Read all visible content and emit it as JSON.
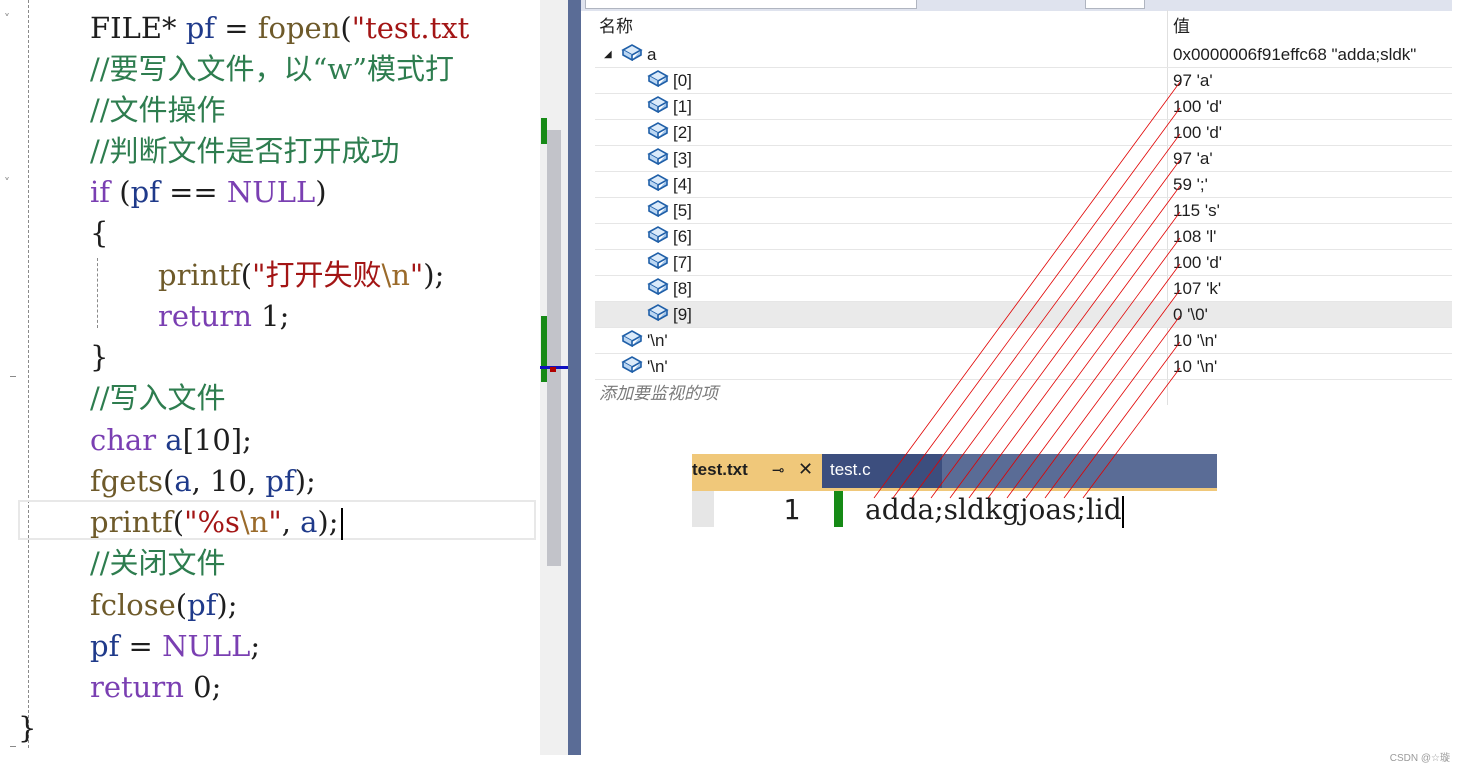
{
  "editor": {
    "lines": [
      [
        {
          "t": "FILE",
          "c": "t-nm"
        },
        {
          "t": "* ",
          "c": "t-nm"
        },
        {
          "t": "pf",
          "c": "t-va"
        },
        {
          "t": " = ",
          "c": "t-nm"
        },
        {
          "t": "fopen",
          "c": "t-fn"
        },
        {
          "t": "(",
          "c": "t-nm"
        },
        {
          "t": "\"test.txt",
          "c": "t-st"
        }
      ],
      [
        {
          "t": "//要写入文件，以“w”模式打",
          "c": "t-cm"
        }
      ],
      [
        {
          "t": "//文件操作",
          "c": "t-cm"
        }
      ],
      [
        {
          "t": "//判断文件是否打开成功",
          "c": "t-cm"
        }
      ],
      [
        {
          "t": "if",
          "c": "t-kw"
        },
        {
          "t": " (",
          "c": "t-nm"
        },
        {
          "t": "pf",
          "c": "t-va"
        },
        {
          "t": " == ",
          "c": "t-nm"
        },
        {
          "t": "NULL",
          "c": "t-mc"
        },
        {
          "t": ")",
          "c": "t-nm"
        }
      ],
      [
        {
          "t": "{",
          "c": "t-nm"
        }
      ],
      [
        {
          "t": "printf",
          "c": "t-fn"
        },
        {
          "t": "(",
          "c": "t-nm"
        },
        {
          "t": "\"打开失败",
          "c": "t-st"
        },
        {
          "t": "\\n",
          "c": "t-es"
        },
        {
          "t": "\"",
          "c": "t-st"
        },
        {
          "t": ");",
          "c": "t-nm"
        }
      ],
      [
        {
          "t": "return",
          "c": "t-kw"
        },
        {
          "t": " 1;",
          "c": "t-nm"
        }
      ],
      [
        {
          "t": "}",
          "c": "t-nm"
        }
      ],
      [
        {
          "t": "//写入文件",
          "c": "t-cm"
        }
      ],
      [
        {
          "t": "char",
          "c": "t-kw"
        },
        {
          "t": " ",
          "c": "t-nm"
        },
        {
          "t": "a",
          "c": "t-va"
        },
        {
          "t": "[10];",
          "c": "t-nm"
        }
      ],
      [
        {
          "t": "fgets",
          "c": "t-fn"
        },
        {
          "t": "(",
          "c": "t-nm"
        },
        {
          "t": "a",
          "c": "t-va"
        },
        {
          "t": ", 10, ",
          "c": "t-nm"
        },
        {
          "t": "pf",
          "c": "t-va"
        },
        {
          "t": ");",
          "c": "t-nm"
        }
      ],
      [
        {
          "t": "printf",
          "c": "t-fn"
        },
        {
          "t": "(",
          "c": "t-nm"
        },
        {
          "t": "\"%s",
          "c": "t-st"
        },
        {
          "t": "\\n",
          "c": "t-es"
        },
        {
          "t": "\"",
          "c": "t-st"
        },
        {
          "t": ", ",
          "c": "t-nm"
        },
        {
          "t": "a",
          "c": "t-va"
        },
        {
          "t": ");",
          "c": "t-nm"
        }
      ],
      [
        {
          "t": "//关闭文件",
          "c": "t-cm"
        }
      ],
      [
        {
          "t": "fclose",
          "c": "t-fn"
        },
        {
          "t": "(",
          "c": "t-nm"
        },
        {
          "t": "pf",
          "c": "t-va"
        },
        {
          "t": ");",
          "c": "t-nm"
        }
      ],
      [
        {
          "t": "pf",
          "c": "t-va"
        },
        {
          "t": " = ",
          "c": "t-nm"
        },
        {
          "t": "NULL",
          "c": "t-mc"
        },
        {
          "t": ";",
          "c": "t-nm"
        }
      ],
      [
        {
          "t": "return",
          "c": "t-kw"
        },
        {
          "t": " 0;",
          "c": "t-nm"
        }
      ],
      [
        {
          "t": "}",
          "c": "t-nm"
        }
      ]
    ]
  },
  "watch": {
    "col_name": "名称",
    "col_value": "值",
    "root": {
      "name": "a",
      "value": "0x0000006f91effc68 \"adda;sldk\""
    },
    "elements": [
      {
        "name": "[0]",
        "value": "97 'a'"
      },
      {
        "name": "[1]",
        "value": "100 'd'"
      },
      {
        "name": "[2]",
        "value": "100 'd'"
      },
      {
        "name": "[3]",
        "value": "97 'a'"
      },
      {
        "name": "[4]",
        "value": "59 ';'"
      },
      {
        "name": "[5]",
        "value": "115 's'"
      },
      {
        "name": "[6]",
        "value": "108 'l'"
      },
      {
        "name": "[7]",
        "value": "100 'd'"
      },
      {
        "name": "[8]",
        "value": "107 'k'"
      },
      {
        "name": "[9]",
        "value": "0 '\\0'"
      }
    ],
    "extra": [
      {
        "name": "'\\n'",
        "value": "10 '\\n'"
      },
      {
        "name": "'\\n'",
        "value": "10 '\\n'"
      }
    ],
    "add_placeholder": "添加要监视的项"
  },
  "file_tabs": {
    "active": "test.txt",
    "inactive": "test.c",
    "pin_icon": "⊸",
    "close_icon": "✕"
  },
  "text_file": {
    "line_number": "1",
    "content": "adda;sldkgjoas;lid"
  },
  "watermark": "CSDN @☆璇",
  "colors": {
    "comment": "#2e7d4f",
    "keyword": "#7a3fb2",
    "string": "#a31515",
    "splitter": "#5a6c96",
    "active_tab": "#f0c87a",
    "change_bar": "#168a16",
    "annotation": "#e00000"
  }
}
